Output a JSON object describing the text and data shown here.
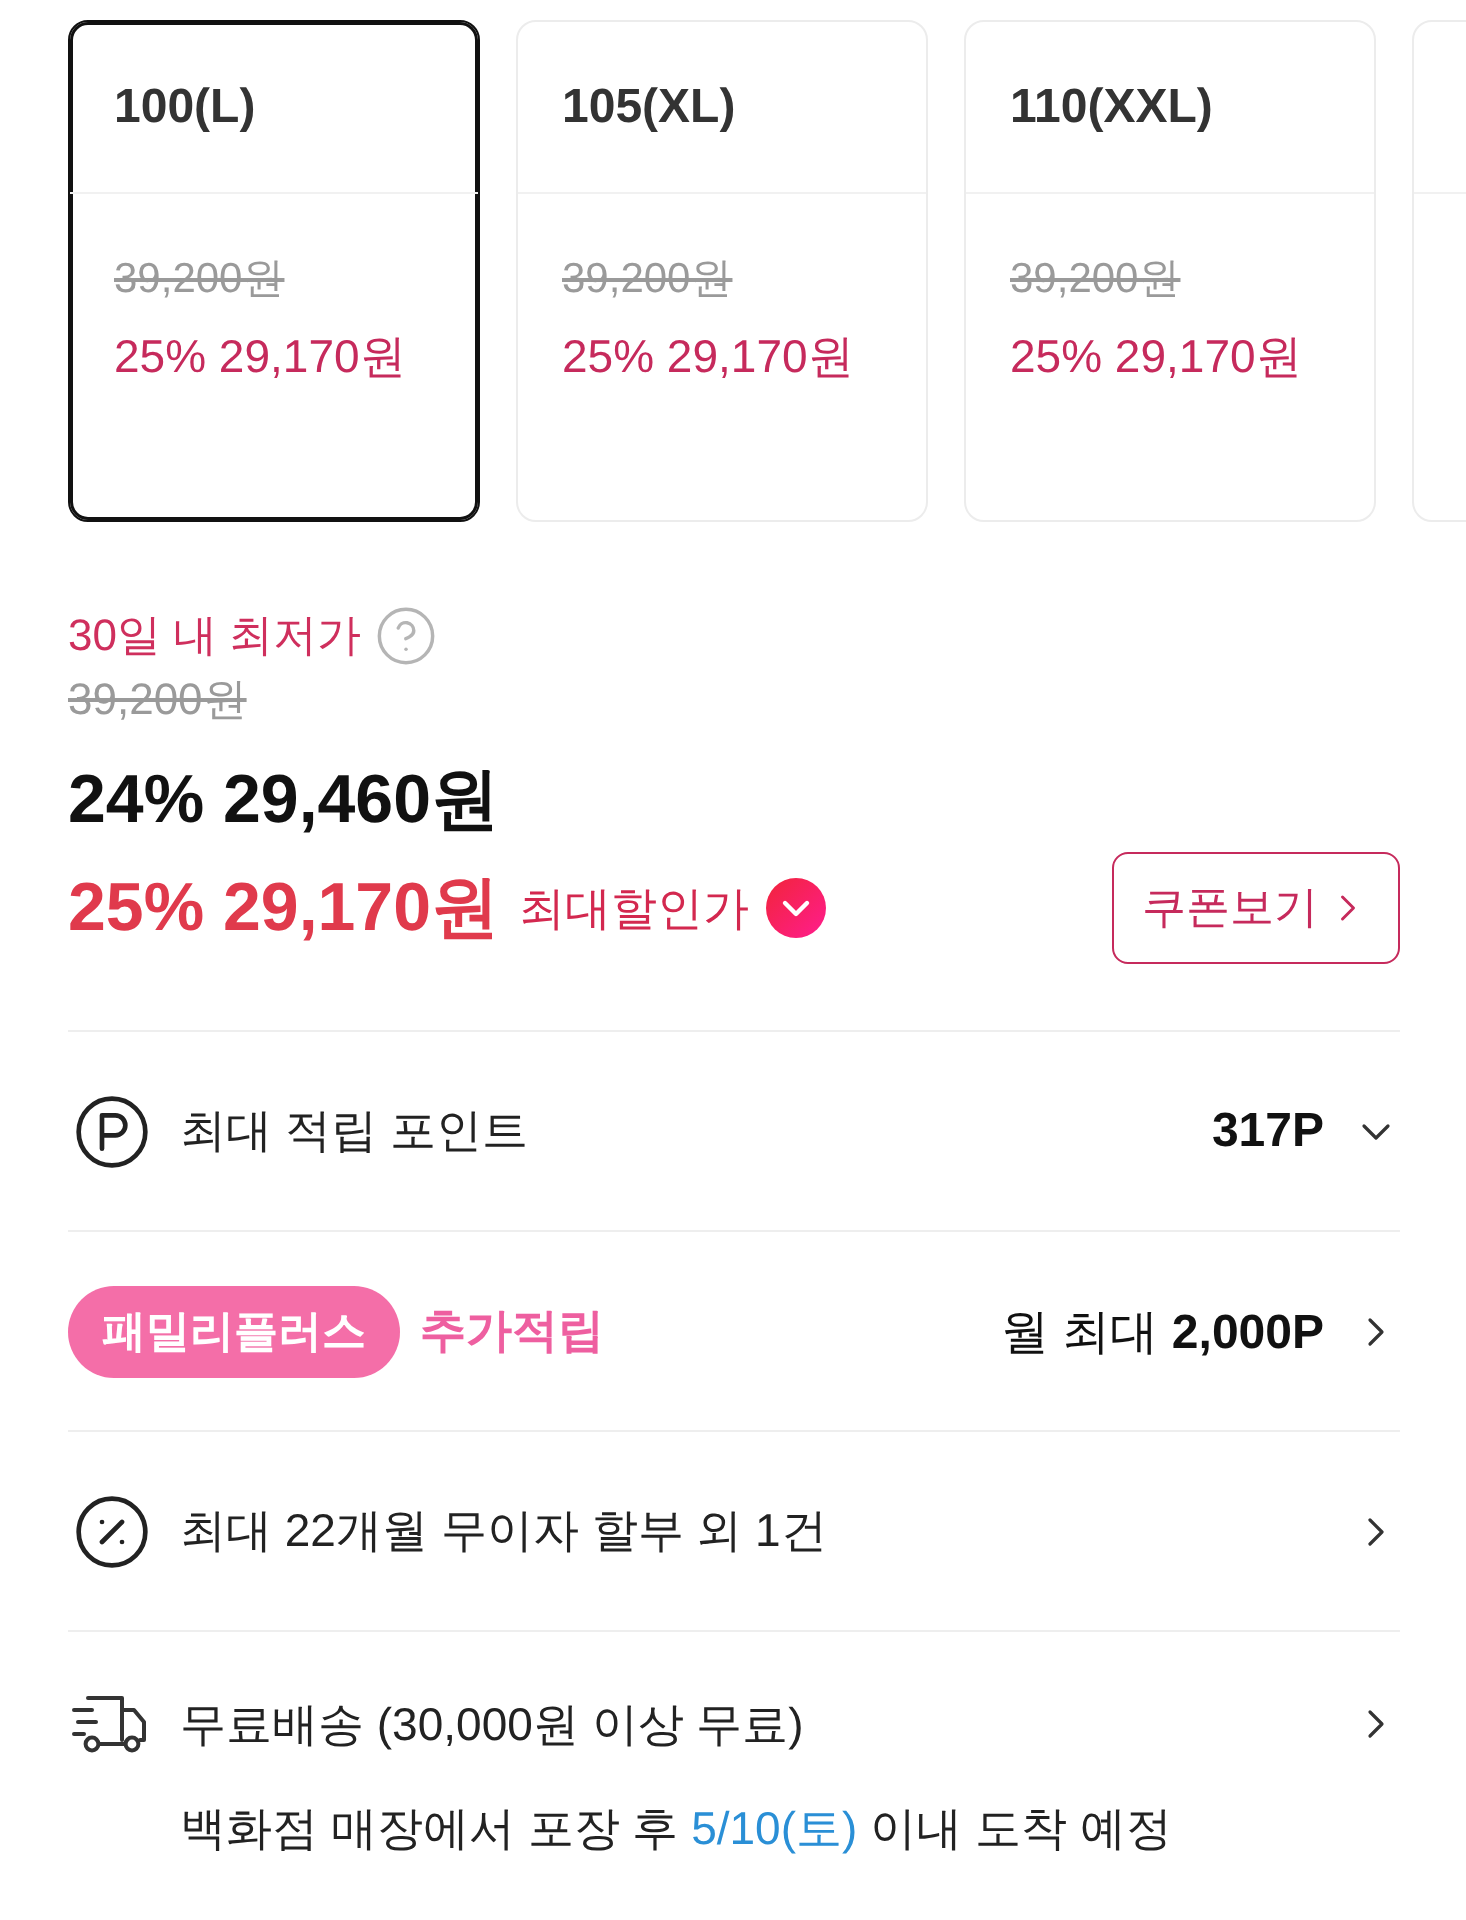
{
  "size_options": [
    {
      "label": "100(L)",
      "original_price": "39,200원",
      "sale_price": "25% 29,170원",
      "selected": true
    },
    {
      "label": "105(XL)",
      "original_price": "39,200원",
      "sale_price": "25% 29,170원",
      "selected": false
    },
    {
      "label": "110(XXL)",
      "original_price": "39,200원",
      "sale_price": "25% 29,170원",
      "selected": false
    },
    {
      "selected": false
    }
  ],
  "price": {
    "lowest_label": "30일 내 최저가",
    "original_price": "39,200원",
    "current_price": "24% 29,460원",
    "max_discount_price": "25% 29,170원",
    "max_discount_label": "최대할인가",
    "coupon_button": "쿠폰보기"
  },
  "info_rows": [
    {
      "kind": "points",
      "label": "최대 적립 포인트",
      "value": "317P"
    },
    {
      "kind": "family",
      "badge": "패밀리플러스",
      "label": "추가적립",
      "value": "월 최대 **2,000P**"
    },
    {
      "kind": "installment",
      "label": "최대 22개월 무이자 할부 외 1건"
    },
    {
      "kind": "shipping",
      "label": "무료배송 (30,000원 이상 무료)",
      "delivery_note": {
        "before": "백화점 매장에서 포장 후",
        "date": "5/10(토)",
        "after": "이내 도착 예정"
      }
    }
  ]
}
